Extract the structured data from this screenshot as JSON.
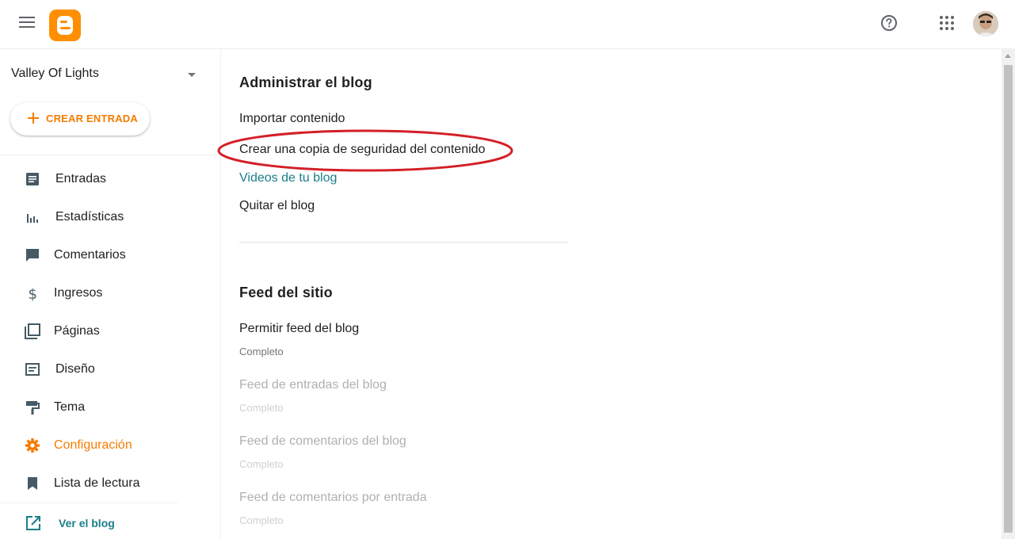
{
  "app": {
    "brand_color": "#ff8f00",
    "accent_color": "#f57c00",
    "link_color": "#1a7f8a"
  },
  "header": {
    "menu_icon": "hamburger-icon",
    "logo_icon": "blogger-logo",
    "help_icon": "help-circle-icon",
    "apps_icon": "apps-grid-icon",
    "avatar_icon": "user-avatar"
  },
  "sidebar": {
    "blog_name": "Valley Of Lights",
    "create_button": "CREAR ENTRADA",
    "items": [
      {
        "label": "Entradas",
        "icon": "posts-icon",
        "active": false
      },
      {
        "label": "Estadísticas",
        "icon": "stats-icon",
        "active": false
      },
      {
        "label": "Comentarios",
        "icon": "comments-icon",
        "active": false
      },
      {
        "label": "Ingresos",
        "icon": "dollar-icon",
        "active": false
      },
      {
        "label": "Páginas",
        "icon": "pages-icon",
        "active": false
      },
      {
        "label": "Diseño",
        "icon": "layout-icon",
        "active": false
      },
      {
        "label": "Tema",
        "icon": "paint-roller-icon",
        "active": false
      },
      {
        "label": "Configuración",
        "icon": "gear-icon",
        "active": true
      },
      {
        "label": "Lista de lectura",
        "icon": "bookmark-icon",
        "active": false
      }
    ],
    "view_blog": "Ver el blog"
  },
  "main": {
    "manage": {
      "title": "Administrar el blog",
      "import": "Importar contenido",
      "backup": "Crear una copia de seguridad del contenido",
      "videos": "Videos de tu blog",
      "remove": "Quitar el blog"
    },
    "feed": {
      "title": "Feed del sitio",
      "allow_feed": {
        "label": "Permitir feed del blog",
        "value": "Completo"
      },
      "posts_feed": {
        "label": "Feed de entradas del blog",
        "value": "Completo"
      },
      "comments_feed": {
        "label": "Feed de comentarios del blog",
        "value": "Completo"
      },
      "per_post_feed": {
        "label": "Feed de comentarios por entrada",
        "value": "Completo"
      }
    }
  }
}
